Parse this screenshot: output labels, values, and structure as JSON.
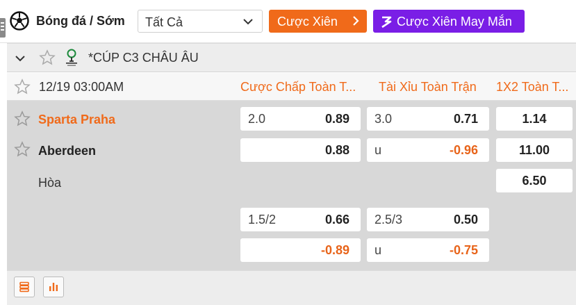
{
  "header": {
    "sport_title": "Bóng đá / Sớm",
    "filter": {
      "selected": "Tất Cả"
    },
    "parlay_button": "Cược Xiên",
    "lucky_parlay_button": "Cược Xiên May Mắn"
  },
  "league": {
    "name": "*CÚP C3 CHÂU ÂU"
  },
  "market_header": {
    "datetime": "12/19 03:00AM",
    "columns": [
      "Cược Chấp Toàn T...",
      "Tài Xỉu Toàn Trận",
      "1X2 Toàn T..."
    ]
  },
  "match": {
    "home_team": "Sparta Praha",
    "away_team": "Aberdeen",
    "draw_label": "Hòa",
    "line1": {
      "handicap": {
        "home_line": "2.0",
        "home_odds": "0.89",
        "away_odds": "0.88"
      },
      "over_under": {
        "over_line": "3.0",
        "over_odds": "0.71",
        "under_label": "u",
        "under_odds": "-0.96"
      },
      "one_x_two": {
        "home": "1.14",
        "away": "11.00",
        "draw": "6.50"
      }
    },
    "line2": {
      "handicap": {
        "home_line": "1.5/2",
        "home_odds": "0.66",
        "away_odds": "-0.89"
      },
      "over_under": {
        "over_line": "2.5/3",
        "over_odds": "0.50",
        "under_label": "u",
        "under_odds": "-0.75"
      }
    }
  },
  "colors": {
    "accent": "#f06a1a",
    "lucky": "#7a1ee6",
    "home_team": "#f06a1a",
    "negative_odds": "#e8641a"
  },
  "icons": {
    "sport": "soccer-ball-icon",
    "footer": [
      "stats-list-icon",
      "bar-chart-icon"
    ]
  }
}
